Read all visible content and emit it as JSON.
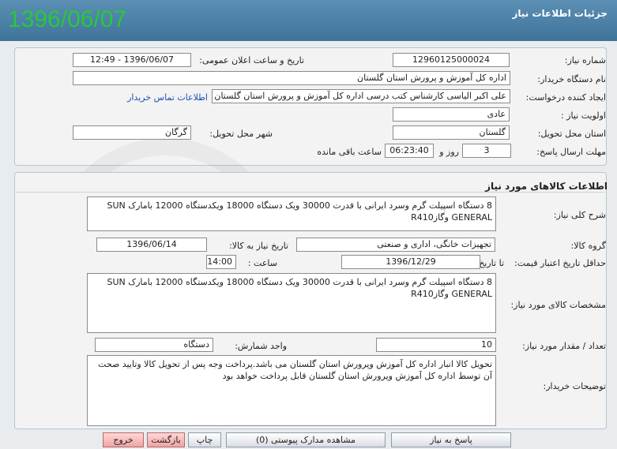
{
  "header": {
    "title": "جزئیات اطلاعات نیاز",
    "big_date": "1396/06/07"
  },
  "need_info": {
    "need_number_label": "شماره نیاز:",
    "need_number": "12960125000024",
    "announce_label": "تاریخ و ساعت اعلان عمومی:",
    "announce_value": "1396/06/07 - 12:49",
    "buyer_label": "نام دستگاه خریدار:",
    "buyer_value": "اداره کل آموزش و پرورش استان گلستان",
    "creator_label": "ایجاد کننده درخواست:",
    "creator_value": "علی اکبر الیاسی کارشناس کتب درسی اداره کل آموزش و پرورش استان گلستان",
    "contact_link": "اطلاعات تماس خریدار",
    "priority_label": "اولویت نیاز :",
    "priority_value": "عادی",
    "province_label": "استان محل تحویل:",
    "province_value": "گلستان",
    "city_label": "شهر محل تحویل:",
    "city_value": "گرگان",
    "deadline_label": "مهلت ارسال پاسخ:",
    "deadline_days": "3",
    "days_word": "روز و",
    "deadline_time": "06:23:40",
    "remaining_label": "ساعت باقی مانده"
  },
  "goods": {
    "section_title": "اطلاعات کالاهای مورد نیاز",
    "summary_label": "شرح کلی نیاز:",
    "summary_value": "8 دستگاه اسپیلت گرم وسرد ایرانی با قدرت 30000 ویک دستگاه 18000 ویکدستگاه 12000 بامارک SUN GENERAL وگازR410",
    "group_label": "گروه کالا:",
    "group_value": "تجهیزات خانگی، اداری و صنعتی",
    "need_date_label": "تاریخ نیاز به کالا:",
    "need_date_value": "1396/06/14",
    "validity_label": "حداقل تاریخ اعتبار قیمت:",
    "until_label": "تا تاریخ :",
    "validity_date": "1396/12/29",
    "hour_label": "ساعت :",
    "validity_time": "14:00",
    "specs_label": "مشخصات کالای مورد نیاز:",
    "specs_value": "8 دستگاه اسپیلت گرم وسرد ایرانی با قدرت 30000 ویک دستگاه 18000 ویکدستگاه 12000 بامارک SUN GENERAL وگازR410",
    "qty_label": "تعداد / مقدار مورد نیاز:",
    "qty_value": "10",
    "unit_label": "واحد شمارش:",
    "unit_value": "دستگاه",
    "notes_label": "توضیحات خریدار:",
    "notes_value": "تحویل کالا انبار اداره کل آموزش وپرورش استان گلستان می باشد.پرداخت وجه پس از تحویل کالا وتایید صحت آن توسط اداره کل آموزش وپرورش استان گلستان قابل پرداخت خواهد بود"
  },
  "buttons": {
    "reply": "پاسخ به نیاز",
    "attachments": "مشاهده مدارک پیوستی (0)",
    "print": "چاپ",
    "back": "بازگشت",
    "exit": "خروج"
  },
  "colors": {
    "header_bg": "#3f7399",
    "date_green": "#26c93c",
    "link_blue": "#1a4fb5"
  }
}
